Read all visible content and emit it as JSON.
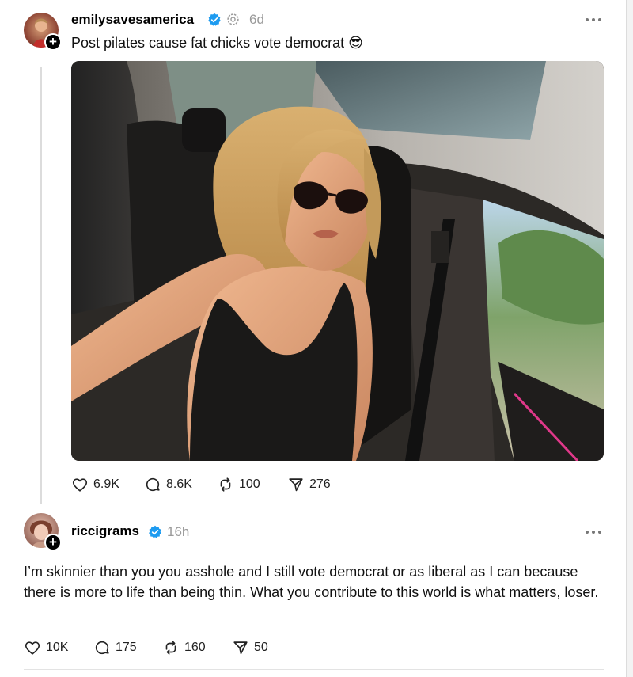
{
  "post": {
    "username": "emilysavesamerica",
    "timestamp": "6d",
    "text": "Post pilates cause fat chicks vote democrat 😎",
    "image_alt": "Selfie of a woman in sunglasses and a black tank top seated in a car",
    "stats": {
      "likes": "6.9K",
      "replies": "8.6K",
      "reposts": "100",
      "shares": "276"
    }
  },
  "reply": {
    "username": "riccigrams",
    "timestamp": "16h",
    "text": "I’m skinnier than you you asshole and I still vote democrat or as liberal as I can because there is more to life than being thin. What you contribute to this world is what matters, loser.",
    "stats": {
      "likes": "10K",
      "replies": "175",
      "reposts": "160",
      "shares": "50"
    }
  },
  "icons": {
    "verified": "verified-badge-icon",
    "threads": "threads-logo-icon",
    "more": "more-options-icon",
    "like": "heart-icon",
    "reply": "comment-icon",
    "repost": "repost-icon",
    "share": "share-icon"
  },
  "colors": {
    "verified": "#1d9bf0",
    "muted_text": "#9a9a9a",
    "background": "#ffffff"
  }
}
